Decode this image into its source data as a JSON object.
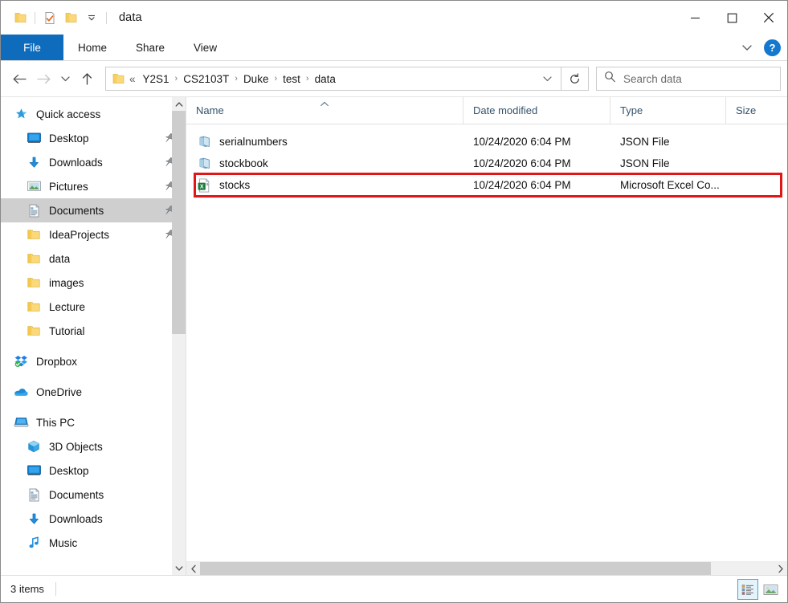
{
  "window": {
    "title": "data",
    "quick_access_toolbar": [
      {
        "name": "folder-icon",
        "label": "Folder"
      },
      {
        "name": "properties-icon",
        "label": "Properties"
      },
      {
        "name": "new-folder-icon",
        "label": "New folder"
      },
      {
        "name": "customize-qat-dropdown-icon",
        "label": "Customize Quick Access Toolbar"
      }
    ],
    "controls": {
      "minimize": "Minimize",
      "maximize": "Maximize",
      "close": "Close"
    }
  },
  "ribbon": {
    "tabs": [
      {
        "label": "File",
        "active": true
      },
      {
        "label": "Home",
        "active": false
      },
      {
        "label": "Share",
        "active": false
      },
      {
        "label": "View",
        "active": false
      }
    ],
    "expand_label": "Expand the Ribbon",
    "help_label": "?"
  },
  "address": {
    "back_label": "Back",
    "forward_label": "Forward",
    "recent_label": "Recent locations",
    "up_label": "Up",
    "prefix": "«",
    "crumbs": [
      "Y2S1",
      "CS2103T",
      "Duke",
      "test",
      "data"
    ],
    "separator": "›",
    "dropdown_label": "Previous locations",
    "refresh_label": "Refresh",
    "search": {
      "placeholder": "Search data",
      "value": ""
    }
  },
  "navpane": {
    "items": [
      {
        "label": "Quick access",
        "icon": "star-icon",
        "indent": 0,
        "pinned": false,
        "selected": false
      },
      {
        "label": "Desktop",
        "icon": "monitor-icon",
        "indent": 1,
        "pinned": true,
        "selected": false
      },
      {
        "label": "Downloads",
        "icon": "download-icon",
        "indent": 1,
        "pinned": true,
        "selected": false
      },
      {
        "label": "Pictures",
        "icon": "pictures-icon",
        "indent": 1,
        "pinned": true,
        "selected": false
      },
      {
        "label": "Documents",
        "icon": "documents-icon",
        "indent": 1,
        "pinned": true,
        "selected": true
      },
      {
        "label": "IdeaProjects",
        "icon": "folder-icon",
        "indent": 1,
        "pinned": true,
        "selected": false
      },
      {
        "label": "data",
        "icon": "folder-icon",
        "indent": 1,
        "pinned": false,
        "selected": false
      },
      {
        "label": "images",
        "icon": "folder-icon",
        "indent": 1,
        "pinned": false,
        "selected": false
      },
      {
        "label": "Lecture",
        "icon": "folder-icon",
        "indent": 1,
        "pinned": false,
        "selected": false
      },
      {
        "label": "Tutorial",
        "icon": "folder-icon",
        "indent": 1,
        "pinned": false,
        "selected": false
      },
      {
        "label": "Dropbox",
        "icon": "dropbox-icon",
        "indent": 0,
        "pinned": false,
        "selected": false,
        "spacer_before": true
      },
      {
        "label": "OneDrive",
        "icon": "onedrive-icon",
        "indent": 0,
        "pinned": false,
        "selected": false,
        "spacer_before": true
      },
      {
        "label": "This PC",
        "icon": "thispc-icon",
        "indent": 0,
        "pinned": false,
        "selected": false,
        "spacer_before": true
      },
      {
        "label": "3D Objects",
        "icon": "3dobjects-icon",
        "indent": 1,
        "pinned": false,
        "selected": false
      },
      {
        "label": "Desktop",
        "icon": "monitor-icon",
        "indent": 1,
        "pinned": false,
        "selected": false
      },
      {
        "label": "Documents",
        "icon": "documents-icon",
        "indent": 1,
        "pinned": false,
        "selected": false
      },
      {
        "label": "Downloads",
        "icon": "download-icon",
        "indent": 1,
        "pinned": false,
        "selected": false
      },
      {
        "label": "Music",
        "icon": "music-icon",
        "indent": 1,
        "pinned": false,
        "selected": false
      }
    ]
  },
  "filelist": {
    "columns": [
      {
        "label": "Name",
        "sorted": true,
        "sort_direction": "ascending"
      },
      {
        "label": "Date modified",
        "sorted": false
      },
      {
        "label": "Type",
        "sorted": false
      },
      {
        "label": "Size",
        "sorted": false
      }
    ],
    "rows": [
      {
        "name": "serialnumbers",
        "date": "10/24/2020 6:04 PM",
        "type": "JSON File",
        "size": "",
        "icon": "json-file-icon",
        "highlighted": false
      },
      {
        "name": "stockbook",
        "date": "10/24/2020 6:04 PM",
        "type": "JSON File",
        "size": "",
        "icon": "json-file-icon",
        "highlighted": false
      },
      {
        "name": "stocks",
        "date": "10/24/2020 6:04 PM",
        "type": "Microsoft Excel Co...",
        "size": "",
        "icon": "excel-csv-icon",
        "highlighted": true
      }
    ],
    "highlight_color": "#e11717"
  },
  "statusbar": {
    "item_count": "3 items",
    "views": [
      {
        "name": "details-view",
        "label": "Details view",
        "active": true
      },
      {
        "name": "large-icons-view",
        "label": "Large icons view",
        "active": false
      }
    ]
  }
}
